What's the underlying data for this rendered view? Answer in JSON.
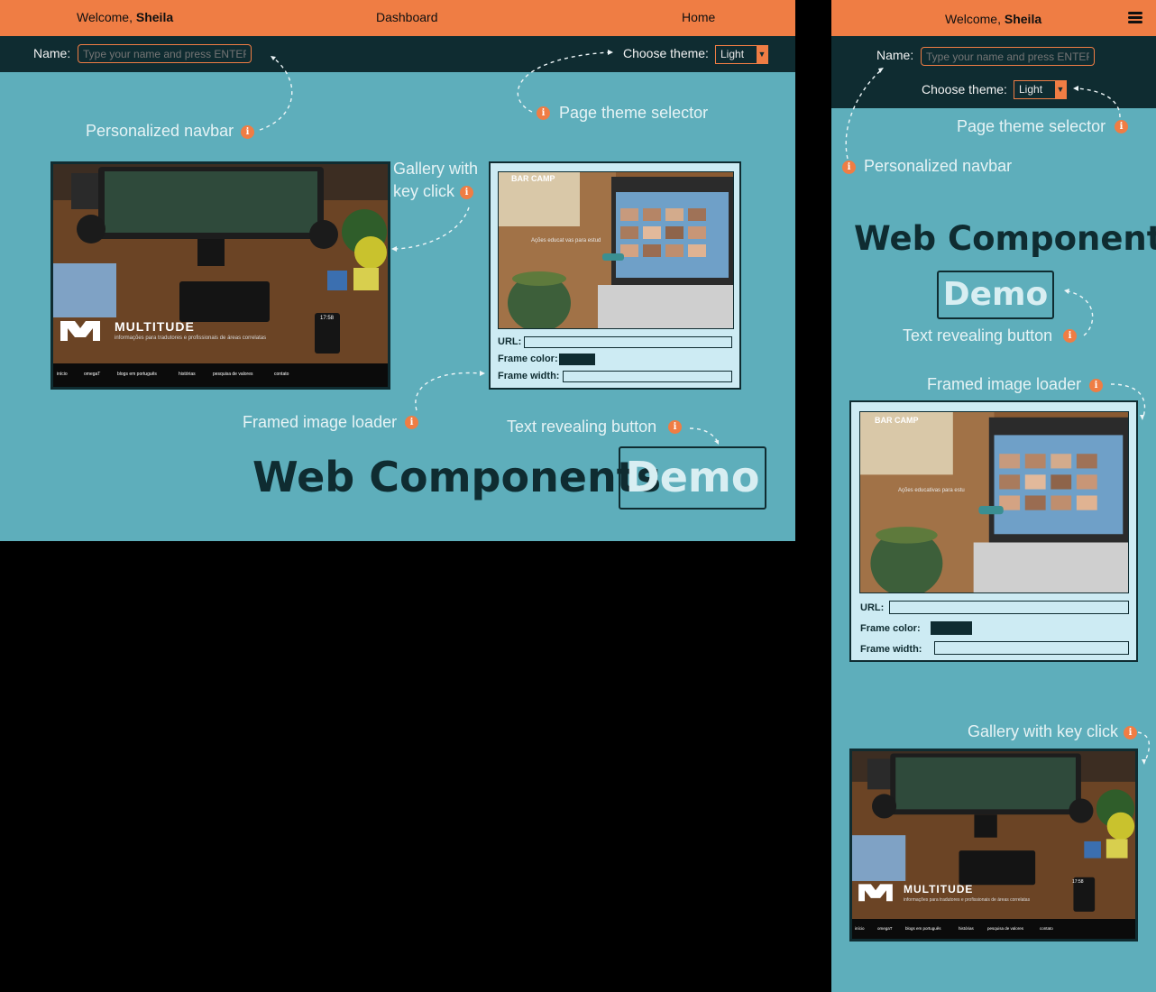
{
  "navbar": {
    "welcome_prefix": "Welcome, ",
    "user_name": "Sheila",
    "dashboard_label": "Dashboard",
    "home_label": "Home"
  },
  "settings": {
    "name_label": "Name:",
    "name_placeholder": "Type your name and press ENTER",
    "theme_label": "Choose theme:",
    "theme_value": "Light"
  },
  "annotations": {
    "navbar": "Personalized navbar",
    "theme": "Page theme selector",
    "gallery_line1": "Gallery with",
    "gallery_line2": "key click",
    "gallery_full": "Gallery with key click",
    "loader": "Framed image loader",
    "text_button": "Text revealing button",
    "info_glyph": "i"
  },
  "hero": {
    "title": "Web Components",
    "button_label": "Demo"
  },
  "gallery": {
    "brand": "MULTITUDE",
    "tagline": "informações para tradutores e profissionais de áreas correlatas",
    "nav": [
      "início",
      "omegaT",
      "blogs em português",
      "histórias",
      "pesquisa de valores",
      "contato"
    ],
    "phone_time": "17:58"
  },
  "loader": {
    "url_label": "URL:",
    "color_label": "Frame color:",
    "width_label": "Frame width:",
    "url_value": "",
    "width_value": "",
    "frame_color": "#0f2c31",
    "site_logo": "BAR CAMP",
    "site_text_desktop": "Ações educat vas para estud",
    "site_text_mobile": "Ações educativas para estu"
  },
  "colors": {
    "accent": "#ef7d44",
    "background": "#5eaebb",
    "dark": "#0f2c31"
  }
}
